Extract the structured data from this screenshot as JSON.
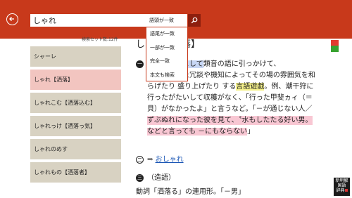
{
  "search": {
    "value": "しゃれ",
    "mode": "語頭が一致"
  },
  "search_modes": [
    "語頭が一致",
    "語尾が一致",
    "一部が一致",
    "完全一致",
    "本文も検索"
  ],
  "result_count": "検索セット数:12件",
  "results": [
    "シャーレ",
    "しゃれ【洒落】",
    "しゃれこむ【洒落込む】",
    "しゃれっけ【洒落っ気】",
    "しゃれのめす",
    "しゃれもの【洒落者】"
  ],
  "entry": {
    "title": "しゃれ【洒落】",
    "sense1": "一",
    "l1a": "の思いつきとして",
    "l1b": "類音の語に引っかけて、",
    "l2": "ちょっとした冗談や機知によってその場の雰囲気を和",
    "l3a": "らげたり 盛り上げたり する",
    "l3b": "言語遊戯",
    "l3c": "。例、潮干狩に",
    "l4": "行ったがたいして収穫がなく、「行った甲斐ヵィ（＝",
    "l5": "貝）がなかったよ」と言うなど。「－が通じない人／",
    "l6": "ずぶぬれになった彼を見て、〝水もしたたる好い男。",
    "l7": "などと言っても －にもならない",
    "l7b": "」",
    "sense2": "二",
    "arrow": "⇒",
    "link": "おしゃれ",
    "sense3": "三",
    "sense3_label": "（造語）",
    "last_line": "動詞「洒落る」の連用形。「－男」"
  },
  "logo_text": "新明解国語辞典"
}
